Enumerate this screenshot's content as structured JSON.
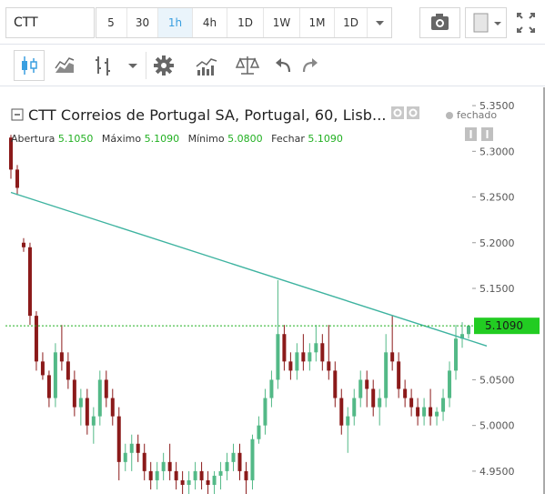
{
  "toolbar": {
    "symbol": "CTT",
    "intervals": [
      "5",
      "30",
      "1h",
      "4h",
      "1D",
      "1W",
      "1M",
      "1D"
    ],
    "active_interval": "1h"
  },
  "legend": {
    "title": "CTT Correios de Portugal SA, Portugal, 60, Lisb...",
    "open_label": "Abertura",
    "open_value": "5.1050",
    "high_label": "Máximo",
    "high_value": "5.1090",
    "low_label": "Mínimo",
    "low_value": "5.0800",
    "close_label": "Fechar",
    "close_value": "5.1090",
    "status": "fechado"
  },
  "colors": {
    "up": "#53b987",
    "down": "#8b1a1a",
    "trendline": "#3eb3a0",
    "price_line": "#22b022",
    "price_tag": "#22cc22",
    "accent": "#3a9fe0"
  },
  "chart_data": {
    "type": "candlestick",
    "y_ticks": [
      "5.3500",
      "5.3000",
      "5.2500",
      "5.2000",
      "5.1500",
      "5.1090",
      "5.0500",
      "5.0000",
      "4.9500"
    ],
    "ylim": [
      4.925,
      5.37
    ],
    "last_price": "5.1090",
    "trendline": {
      "start": 5.255,
      "end": 5.087
    },
    "ohlc": [
      [
        5.315,
        5.318,
        5.27,
        5.28
      ],
      [
        5.28,
        5.285,
        5.252,
        5.26
      ],
      [
        5.2,
        5.205,
        5.19,
        5.195
      ],
      [
        5.195,
        5.2,
        5.11,
        5.12
      ],
      [
        5.12,
        5.125,
        5.06,
        5.07
      ],
      [
        5.07,
        5.08,
        5.05,
        5.055
      ],
      [
        5.055,
        5.06,
        5.02,
        5.03
      ],
      [
        5.03,
        5.09,
        5.02,
        5.08
      ],
      [
        5.08,
        5.11,
        5.06,
        5.07
      ],
      [
        5.07,
        5.08,
        5.04,
        5.05
      ],
      [
        5.05,
        5.06,
        5.01,
        5.02
      ],
      [
        5.02,
        5.04,
        5.0,
        5.03
      ],
      [
        5.03,
        5.04,
        4.99,
        5.0
      ],
      [
        5.0,
        5.02,
        4.98,
        5.01
      ],
      [
        5.01,
        5.06,
        5.0,
        5.05
      ],
      [
        5.05,
        5.06,
        5.02,
        5.03
      ],
      [
        5.03,
        5.04,
        5.0,
        5.01
      ],
      [
        5.01,
        5.02,
        4.94,
        4.96
      ],
      [
        4.96,
        4.98,
        4.95,
        4.97
      ],
      [
        4.97,
        4.99,
        4.95,
        4.98
      ],
      [
        4.98,
        4.99,
        4.96,
        4.97
      ],
      [
        4.97,
        4.98,
        4.94,
        4.95
      ],
      [
        4.95,
        4.96,
        4.93,
        4.94
      ],
      [
        4.94,
        4.96,
        4.93,
        4.95
      ],
      [
        4.95,
        4.97,
        4.94,
        4.96
      ],
      [
        4.96,
        4.98,
        4.94,
        4.95
      ],
      [
        4.95,
        4.96,
        4.93,
        4.94
      ],
      [
        4.94,
        4.95,
        4.925,
        4.935
      ],
      [
        4.935,
        4.95,
        4.925,
        4.94
      ],
      [
        4.94,
        4.96,
        4.93,
        4.95
      ],
      [
        4.95,
        4.96,
        4.93,
        4.94
      ],
      [
        4.94,
        4.95,
        4.92,
        4.935
      ],
      [
        4.935,
        4.95,
        4.925,
        4.945
      ],
      [
        4.945,
        4.96,
        4.93,
        4.95
      ],
      [
        4.95,
        4.97,
        4.94,
        4.96
      ],
      [
        4.96,
        4.98,
        4.95,
        4.97
      ],
      [
        4.97,
        4.98,
        4.94,
        4.95
      ],
      [
        4.95,
        4.96,
        4.92,
        4.94
      ],
      [
        4.94,
        4.99,
        4.93,
        4.985
      ],
      [
        4.985,
        5.01,
        4.98,
        5.0
      ],
      [
        5.0,
        5.04,
        4.99,
        5.03
      ],
      [
        5.03,
        5.06,
        5.02,
        5.05
      ],
      [
        5.05,
        5.159,
        5.04,
        5.1
      ],
      [
        5.1,
        5.11,
        5.06,
        5.07
      ],
      [
        5.07,
        5.08,
        5.05,
        5.06
      ],
      [
        5.06,
        5.09,
        5.05,
        5.08
      ],
      [
        5.08,
        5.1,
        5.06,
        5.07
      ],
      [
        5.07,
        5.09,
        5.06,
        5.08
      ],
      [
        5.08,
        5.11,
        5.07,
        5.09
      ],
      [
        5.09,
        5.1,
        5.06,
        5.07
      ],
      [
        5.07,
        5.11,
        5.05,
        5.06
      ],
      [
        5.06,
        5.07,
        5.02,
        5.03
      ],
      [
        5.03,
        5.04,
        4.99,
        5.0
      ],
      [
        5.0,
        5.02,
        4.97,
        5.01
      ],
      [
        5.01,
        5.04,
        5.0,
        5.03
      ],
      [
        5.03,
        5.06,
        5.02,
        5.05
      ],
      [
        5.05,
        5.06,
        5.02,
        5.04
      ],
      [
        5.04,
        5.05,
        5.01,
        5.02
      ],
      [
        5.02,
        5.04,
        5.0,
        5.03
      ],
      [
        5.03,
        5.1,
        5.02,
        5.08
      ],
      [
        5.08,
        5.12,
        5.06,
        5.07
      ],
      [
        5.07,
        5.08,
        5.03,
        5.04
      ],
      [
        5.04,
        5.05,
        5.02,
        5.03
      ],
      [
        5.03,
        5.04,
        5.01,
        5.02
      ],
      [
        5.02,
        5.03,
        5.0,
        5.01
      ],
      [
        5.01,
        5.03,
        5.0,
        5.02
      ],
      [
        5.02,
        5.04,
        5.0,
        5.01
      ],
      [
        5.01,
        5.02,
        5.0,
        5.015
      ],
      [
        5.015,
        5.04,
        5.005,
        5.03
      ],
      [
        5.03,
        5.07,
        5.02,
        5.06
      ],
      [
        5.06,
        5.11,
        5.05,
        5.095
      ],
      [
        5.095,
        5.113,
        5.085,
        5.1
      ],
      [
        5.1,
        5.11,
        5.095,
        5.109
      ]
    ]
  }
}
